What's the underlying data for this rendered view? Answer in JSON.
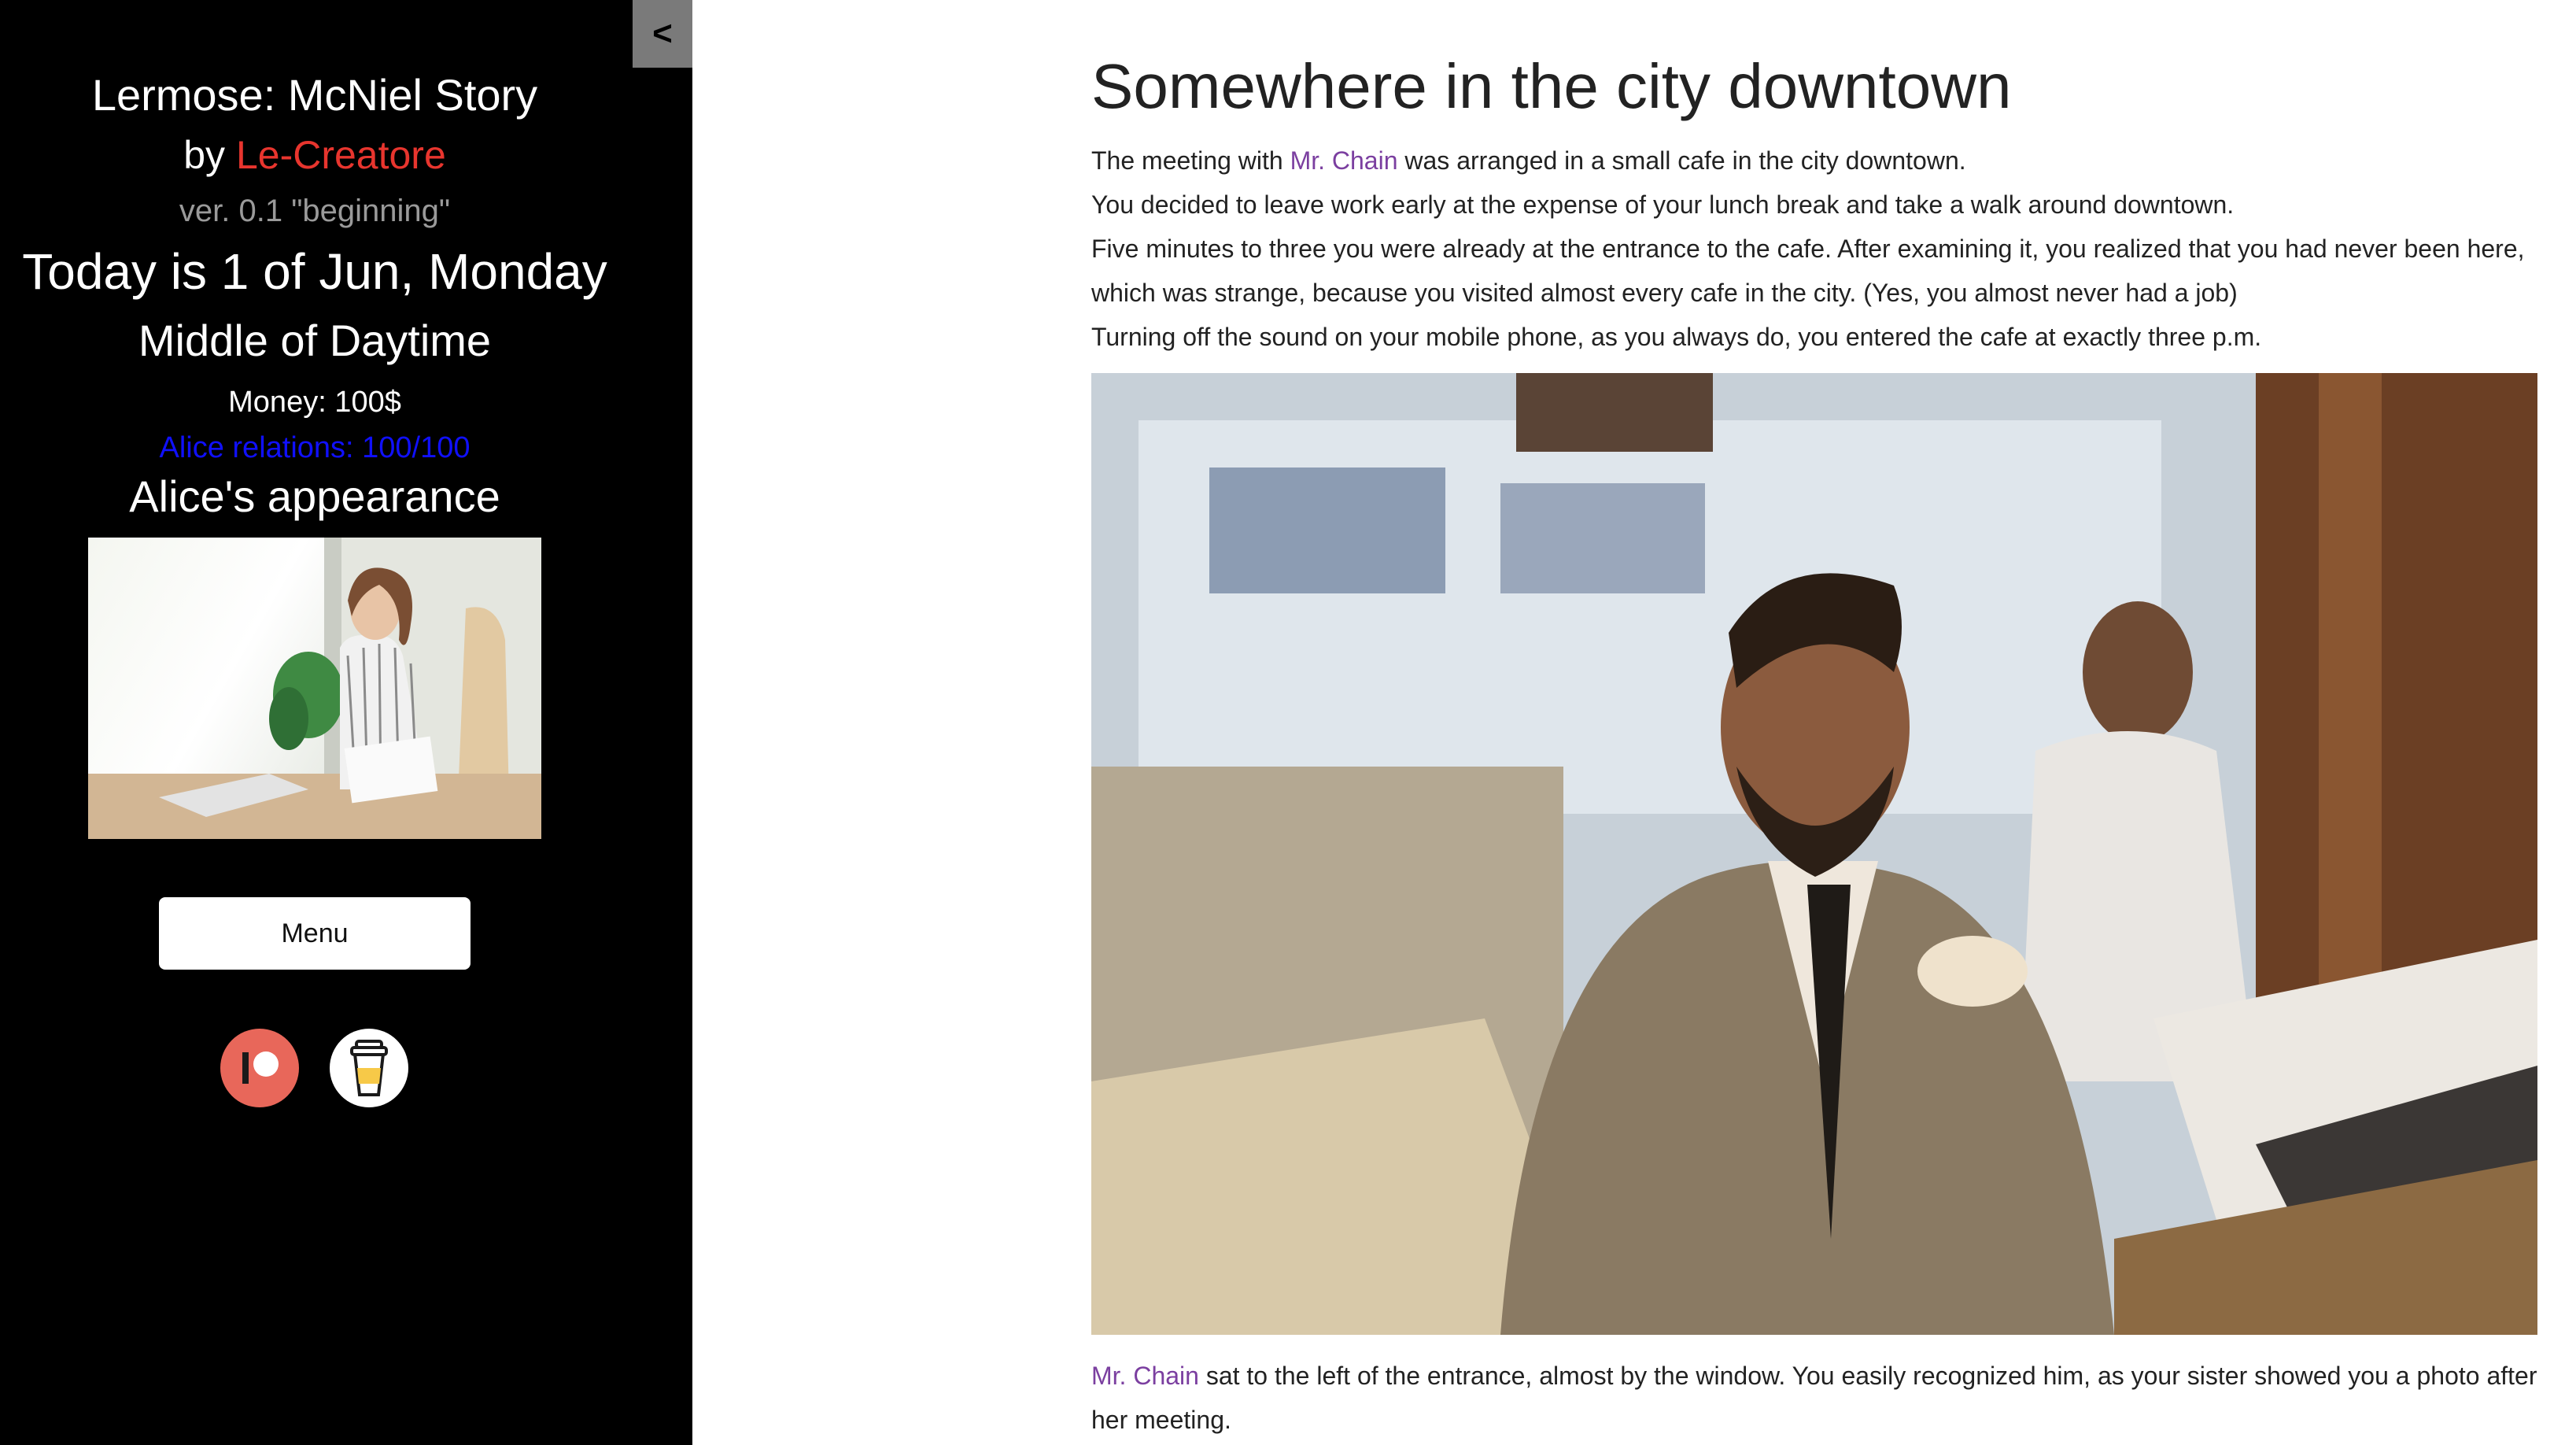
{
  "sidebar": {
    "collapse_label": "<",
    "title": "Lermose: McNiel Story",
    "by_prefix": "by ",
    "author": "Le-Creatore",
    "version": "ver. 0.1 \"beginning\"",
    "date": "Today is 1 of Jun, Monday",
    "time_of_day": "Middle of Daytime",
    "money": "Money: 100$",
    "relations": "Alice relations: 100/100",
    "appearance_heading": "Alice's appearance",
    "menu_label": "Menu",
    "icons": [
      "patreon-icon",
      "buy-me-a-coffee-icon"
    ]
  },
  "scene": {
    "title": "Somewhere in the city downtown",
    "p1_before": "The meeting with ",
    "p1_char": "Mr. Chain",
    "p1_after": " was arranged in a small cafe in the city downtown.",
    "p2": "You decided to leave work early at the expense of your lunch break and take a walk around downtown.",
    "p3": "Five minutes to three you were already at the entrance to the cafe. After examining it, you realized that you had never been here, which was strange, because you visited almost every cafe in the city. (Yes, you almost never had a job)",
    "p4": "Turning off the sound on your mobile phone, as you always do, you entered the cafe at exactly three p.m.",
    "p5_char": "Mr. Chain",
    "p5_after": " sat to the left of the entrance, almost by the window. You easily recognized him, as your sister showed you a photo after her meeting."
  },
  "colors": {
    "sidebar_bg": "#000000",
    "author": "#e8352e",
    "relations": "#1010ff",
    "character_link": "#7b3fa0",
    "patreon": "#e8675a"
  }
}
